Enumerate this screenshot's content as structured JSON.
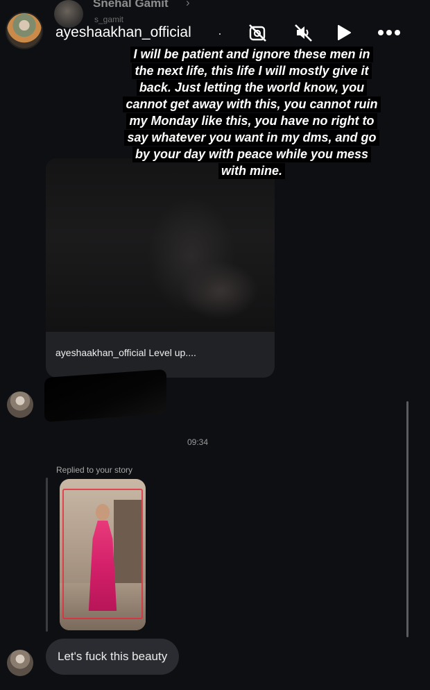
{
  "chat_header": {
    "name": "Snehal Gamit",
    "username": "s_gamit",
    "chevron_icon": "chevron-right-icon"
  },
  "story": {
    "username": "ayeshaakhan_official",
    "separator": "·",
    "icons": [
      "no-camera-icon",
      "mute-icon",
      "play-icon",
      "more-icon"
    ],
    "caption_lines": [
      "I will be patient and ignore these men in",
      "the next life, this life I will mostly give it",
      "back. Just letting the world know, you",
      "cannot get away with this, you cannot ruin",
      "my Monday like this, you have no right to",
      "say whatever you want in my dms, and go",
      "by your day with peace while you mess",
      "with mine."
    ]
  },
  "shared_post": {
    "caption": "ayeshaakhan_official Level up...."
  },
  "conversation": {
    "timestamp": "09:34",
    "reply_label": "Replied to your story",
    "story_thumb_text": "",
    "last_message": "Let's fuck this beauty"
  },
  "colors": {
    "background": "#0d0f12",
    "bubble": "#2a2c31",
    "card": "#202226"
  }
}
